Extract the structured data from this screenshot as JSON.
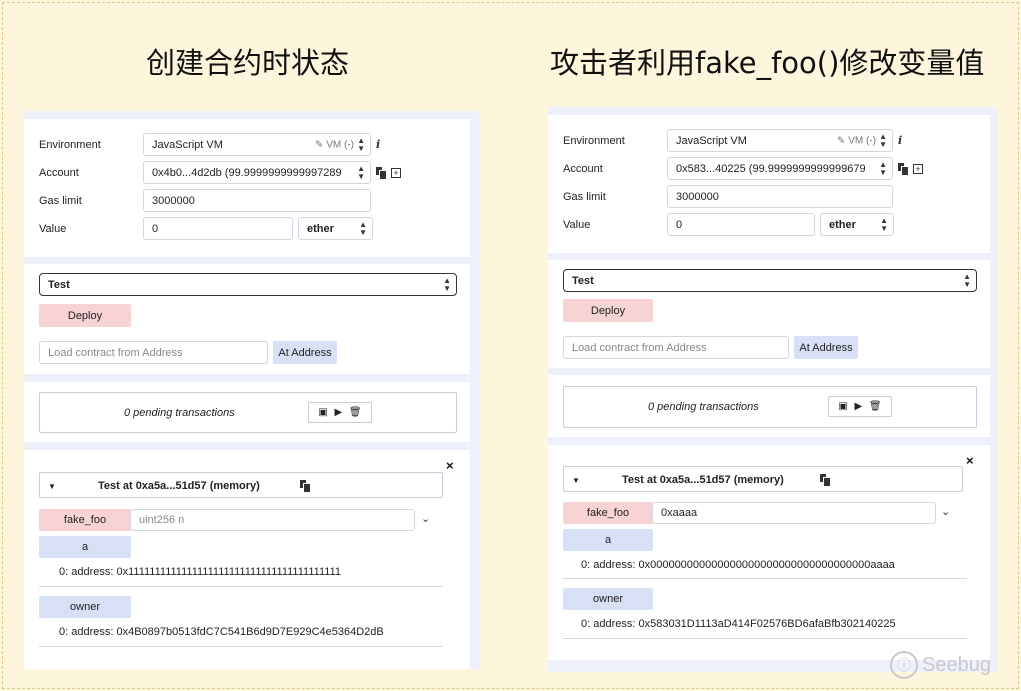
{
  "headings": {
    "left": "创建合约时状态",
    "right": "攻击者利用fake_foo()修改变量值"
  },
  "labels": {
    "environment": "Environment",
    "account": "Account",
    "gas_limit": "Gas limit",
    "value": "Value"
  },
  "left": {
    "environment": "JavaScript VM",
    "environment_extra": "VM (-)",
    "account": "0x4b0...4d2db (99.9999999999997289",
    "gas_limit": "3000000",
    "value": "0",
    "unit": "ether",
    "contract": "Test",
    "deploy": "Deploy",
    "load_placeholder": "Load contract from Address",
    "at_address": "At Address",
    "pending": "0 pending transactions",
    "instance_title": "Test at 0xa5a...51d57 (memory)",
    "fake_foo_label": "fake_foo",
    "fake_foo_placeholder": "uint256 n",
    "fake_foo_value": "",
    "a_label": "a",
    "a_result": "0: address: 0x1111111111111111111111111111111111111111",
    "owner_label": "owner",
    "owner_result": "0: address: 0x4B0897b0513fdC7C541B6d9D7E929C4e5364D2dB"
  },
  "right": {
    "environment": "JavaScript VM",
    "environment_extra": "VM (-)",
    "account": "0x583...40225 (99.9999999999999679",
    "gas_limit": "3000000",
    "value": "0",
    "unit": "ether",
    "contract": "Test",
    "deploy": "Deploy",
    "load_placeholder": "Load contract from Address",
    "at_address": "At Address",
    "pending": "0 pending transactions",
    "instance_title": "Test at 0xa5a...51d57 (memory)",
    "fake_foo_label": "fake_foo",
    "fake_foo_value": "0xaaaa",
    "a_label": "a",
    "a_result": "0: address: 0x000000000000000000000000000000000000aaaa",
    "owner_label": "owner",
    "owner_result": "0: address: 0x583031D1113aD414F02576BD6afaBfb302140225"
  },
  "watermark": "Seebug"
}
